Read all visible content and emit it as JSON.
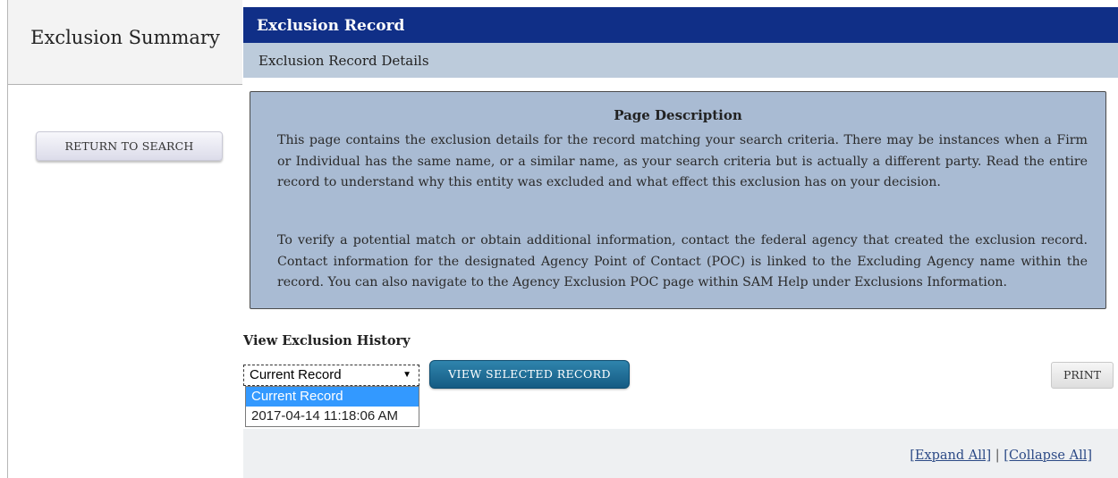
{
  "sidebar": {
    "title": "Exclusion Summary",
    "return_button": "RETURN TO SEARCH"
  },
  "header": {
    "title": "Exclusion Record",
    "subtitle": "Exclusion Record Details"
  },
  "description": {
    "title": "Page Description",
    "paragraph1": "This page contains the exclusion details for the record matching your search criteria. There may be instances when a Firm or Individual has the same name, or a similar name, as your search criteria but is actually a different party. Read the entire record to understand why this entity was excluded and what effect this exclusion has on your decision.",
    "paragraph2": "To verify a potential match or obtain additional information, contact the federal agency that created the exclusion record. Contact information for the designated Agency Point of Contact (POC) is linked to the Excluding Agency name within the record. You can also navigate to the Agency Exclusion POC page within SAM Help under Exclusions Information."
  },
  "history": {
    "label": "View Exclusion History",
    "selected_value": "Current Record",
    "options": [
      "Current Record",
      "2017-04-14 11:18:06 AM"
    ],
    "view_button": "VIEW SELECTED RECORD"
  },
  "toolbar": {
    "print_button": "PRINT",
    "expand_all": "[Expand All]",
    "separator": "|",
    "collapse_all": "[Collapse All]"
  },
  "colors": {
    "header_blue": "#102f87",
    "subheader": "#bccbdb",
    "panel": "#a9bbd3",
    "view_button": "#1f6f97",
    "dropdown_highlight": "#3399ff"
  },
  "icons": {
    "select_arrow": "dropdown-arrow-icon"
  }
}
